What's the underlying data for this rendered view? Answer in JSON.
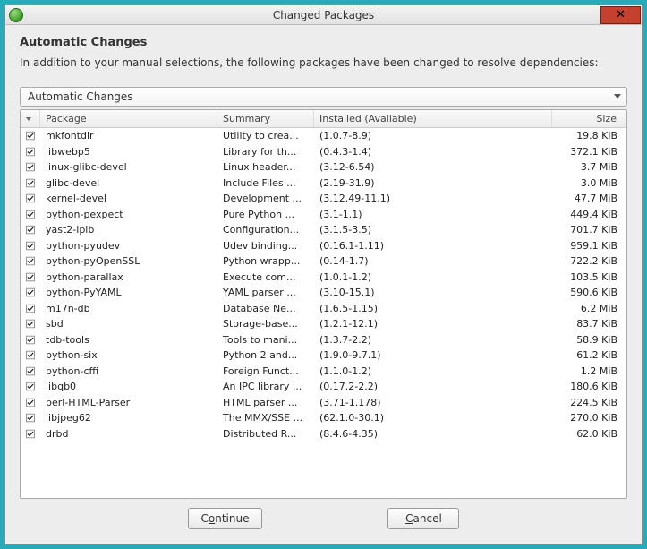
{
  "window": {
    "title": "Changed Packages"
  },
  "heading": "Automatic Changes",
  "subtext": "In addition to your manual selections, the following packages have been changed to resolve dependencies:",
  "dropdown": {
    "label": "Automatic Changes"
  },
  "columns": {
    "package": "Package",
    "summary": "Summary",
    "installed": "Installed (Available)",
    "size": "Size"
  },
  "rows": [
    {
      "pkg": "mkfontdir",
      "sum": "Utility to crea...",
      "inst": "(1.0.7-8.9)",
      "size": "19.8 KiB"
    },
    {
      "pkg": "libwebp5",
      "sum": "Library for th...",
      "inst": "(0.4.3-1.4)",
      "size": "372.1 KiB"
    },
    {
      "pkg": "linux-glibc-devel",
      "sum": "Linux header...",
      "inst": "(3.12-6.54)",
      "size": "3.7 MiB"
    },
    {
      "pkg": "glibc-devel",
      "sum": "Include Files ...",
      "inst": "(2.19-31.9)",
      "size": "3.0 MiB"
    },
    {
      "pkg": "kernel-devel",
      "sum": "Development ...",
      "inst": "(3.12.49-11.1)",
      "size": "47.7 MiB"
    },
    {
      "pkg": "python-pexpect",
      "sum": "Pure Python ...",
      "inst": "(3.1-1.1)",
      "size": "449.4 KiB"
    },
    {
      "pkg": "yast2-iplb",
      "sum": "Configuration...",
      "inst": "(3.1.5-3.5)",
      "size": "701.7 KiB"
    },
    {
      "pkg": "python-pyudev",
      "sum": "Udev binding...",
      "inst": "(0.16.1-1.11)",
      "size": "959.1 KiB"
    },
    {
      "pkg": "python-pyOpenSSL",
      "sum": "Python wrapp...",
      "inst": "(0.14-1.7)",
      "size": "722.2 KiB"
    },
    {
      "pkg": "python-parallax",
      "sum": "Execute com...",
      "inst": "(1.0.1-1.2)",
      "size": "103.5 KiB"
    },
    {
      "pkg": "python-PyYAML",
      "sum": "YAML parser ...",
      "inst": "(3.10-15.1)",
      "size": "590.6 KiB"
    },
    {
      "pkg": "m17n-db",
      "sum": "Database Ne...",
      "inst": "(1.6.5-1.15)",
      "size": "6.2 MiB"
    },
    {
      "pkg": "sbd",
      "sum": "Storage-base...",
      "inst": "(1.2.1-12.1)",
      "size": "83.7 KiB"
    },
    {
      "pkg": "tdb-tools",
      "sum": "Tools to mani...",
      "inst": "(1.3.7-2.2)",
      "size": "58.9 KiB"
    },
    {
      "pkg": "python-six",
      "sum": "Python 2 and...",
      "inst": "(1.9.0-9.7.1)",
      "size": "61.2 KiB"
    },
    {
      "pkg": "python-cffi",
      "sum": "Foreign Funct...",
      "inst": "(1.1.0-1.2)",
      "size": "1.2 MiB"
    },
    {
      "pkg": "libqb0",
      "sum": "An IPC library ...",
      "inst": "(0.17.2-2.2)",
      "size": "180.6 KiB"
    },
    {
      "pkg": "perl-HTML-Parser",
      "sum": "HTML parser ...",
      "inst": "(3.71-1.178)",
      "size": "224.5 KiB"
    },
    {
      "pkg": "libjpeg62",
      "sum": "The MMX/SSE ...",
      "inst": "(62.1.0-30.1)",
      "size": "270.0 KiB"
    },
    {
      "pkg": "drbd",
      "sum": "Distributed R...",
      "inst": "(8.4.6-4.35)",
      "size": "62.0 KiB"
    }
  ],
  "buttons": {
    "continue": {
      "pre": "C",
      "u": "o",
      "post": "ntinue"
    },
    "cancel": {
      "pre": "",
      "u": "C",
      "post": "ancel"
    }
  }
}
